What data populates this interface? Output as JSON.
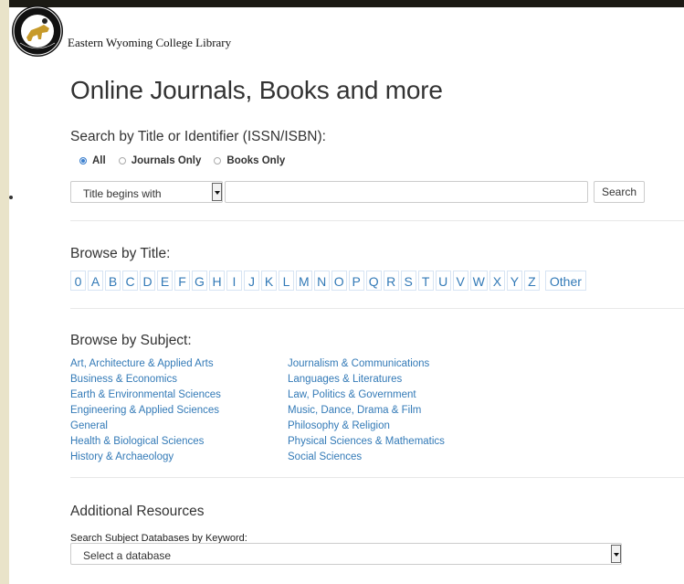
{
  "header": {
    "logo_text": "EASTERN WYOMING COLLEGE",
    "site_name": "Eastern Wyoming College Library"
  },
  "page_title": "Online Journals, Books and more",
  "search": {
    "label": "Search by Title or Identifier (ISSN/ISBN):",
    "options": [
      {
        "label": "All",
        "selected": true
      },
      {
        "label": "Journals Only",
        "selected": false
      },
      {
        "label": "Books Only",
        "selected": false
      }
    ],
    "mode_select": "Title begins with",
    "input_value": "",
    "button": "Search"
  },
  "browse_title": {
    "label": "Browse by Title:",
    "letters": [
      "0",
      "A",
      "B",
      "C",
      "D",
      "E",
      "F",
      "G",
      "H",
      "I",
      "J",
      "K",
      "L",
      "M",
      "N",
      "O",
      "P",
      "Q",
      "R",
      "S",
      "T",
      "U",
      "V",
      "W",
      "X",
      "Y",
      "Z",
      "Other"
    ]
  },
  "browse_subject": {
    "label": "Browse by Subject:",
    "column1": [
      "Art, Architecture & Applied Arts",
      "Business & Economics",
      "Earth & Environmental Sciences",
      "Engineering & Applied Sciences",
      "General",
      "Health & Biological Sciences",
      "History & Archaeology"
    ],
    "column2": [
      "Journalism & Communications",
      "Languages & Literatures",
      "Law, Politics & Government",
      "Music, Dance, Drama & Film",
      "Philosophy & Religion",
      "Physical Sciences & Mathematics",
      "Social Sciences"
    ]
  },
  "additional": {
    "label": "Additional Resources",
    "keyword_label": "Search Subject Databases by Keyword:",
    "db_select": "Select a database"
  },
  "colors": {
    "link": "#337ab7",
    "text": "#333333",
    "background_left": "#e9e3c9",
    "radio_selected": "#3b7fce"
  }
}
